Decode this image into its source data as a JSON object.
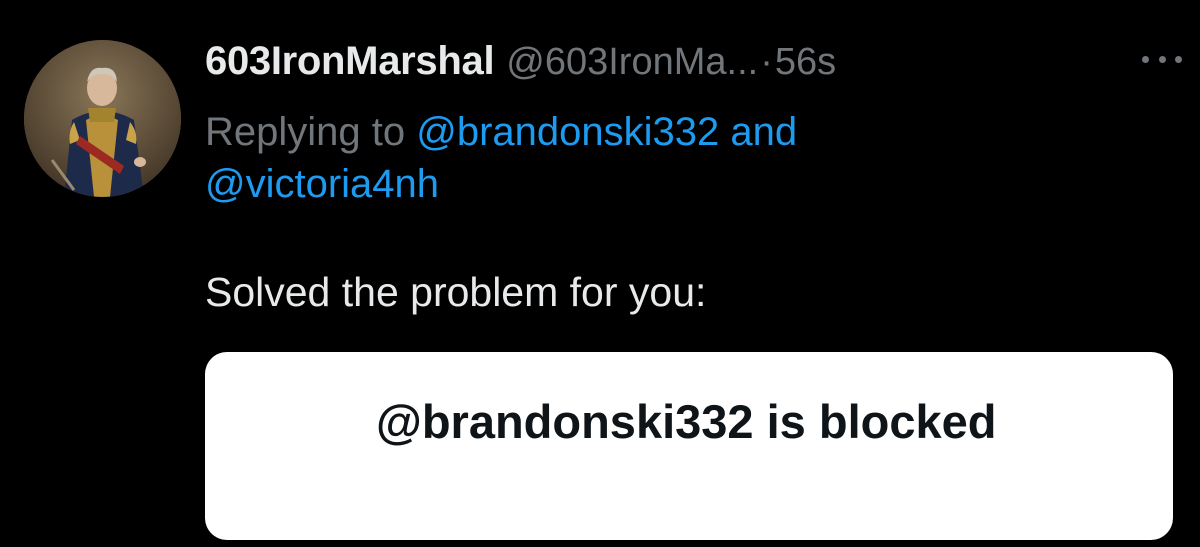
{
  "tweet": {
    "display_name": "603IronMarshal",
    "handle": "@603IronMa...",
    "separator": "·",
    "time": "56s",
    "more_label": "More options",
    "replying_prefix": "Replying to ",
    "mention_1": "@brandonski332",
    "replying_and": " and",
    "mention_2": "@victoria4nh",
    "text": "Solved the problem for you:",
    "embedded_card": {
      "mention": "@brandonski332",
      "text_rest": " is blocked"
    }
  },
  "icons": {
    "avatar": "portrait-avatar",
    "more": "ellipsis-icon"
  },
  "colors": {
    "background": "#000000",
    "primary_text": "#e7e9ea",
    "secondary_text": "#71767b",
    "accent": "#1d9bf0",
    "card_background": "#ffffff",
    "card_text": "#0f1419"
  }
}
